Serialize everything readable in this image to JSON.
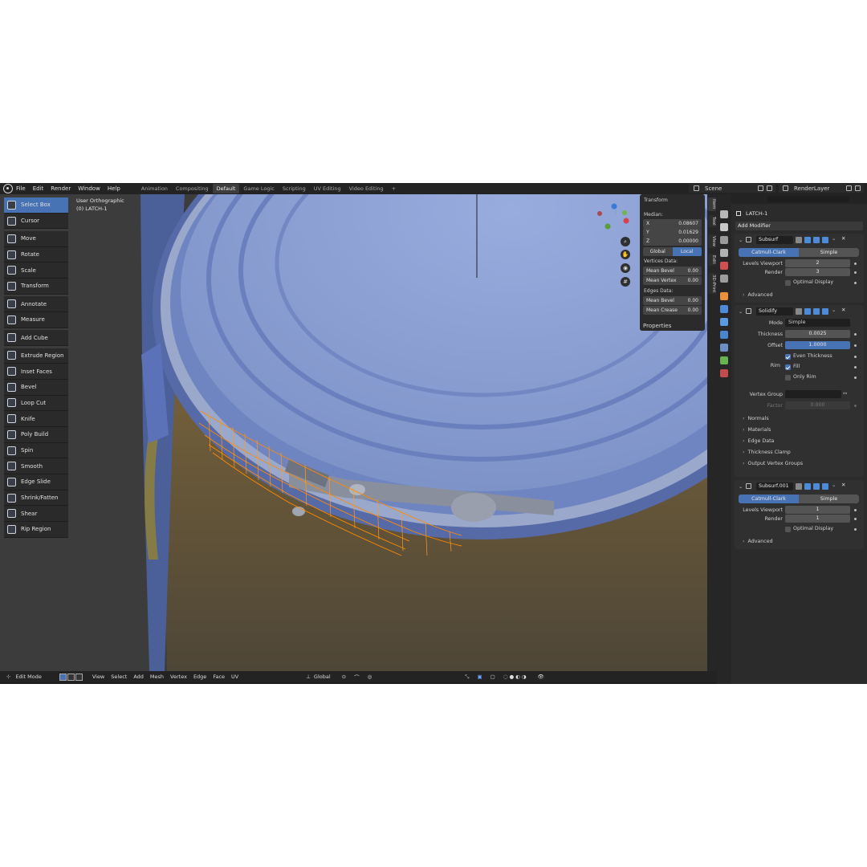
{
  "menu": [
    "File",
    "Edit",
    "Render",
    "Window",
    "Help"
  ],
  "workspaces": [
    "Animation",
    "Compositing",
    "Default",
    "Game Logic",
    "Scripting",
    "UV Editing",
    "Video Editing"
  ],
  "workspace_add": "+",
  "scene": "Scene",
  "render_layer": "RenderLayer",
  "tools": [
    {
      "label": "Select Box",
      "active": true
    },
    {
      "label": "Cursor"
    },
    {
      "label": "Move"
    },
    {
      "label": "Rotate"
    },
    {
      "label": "Scale"
    },
    {
      "label": "Transform"
    },
    {
      "label": "Annotate"
    },
    {
      "label": "Measure"
    },
    {
      "label": "Add Cube"
    },
    {
      "label": "Extrude Region"
    },
    {
      "label": "Inset Faces"
    },
    {
      "label": "Bevel"
    },
    {
      "label": "Loop Cut"
    },
    {
      "label": "Knife"
    },
    {
      "label": "Poly Build"
    },
    {
      "label": "Spin"
    },
    {
      "label": "Smooth"
    },
    {
      "label": "Edge Slide"
    },
    {
      "label": "Shrink/Fatten"
    },
    {
      "label": "Shear"
    },
    {
      "label": "Rip Region"
    }
  ],
  "viewport": {
    "view_name": "User Orthographic",
    "object_name": "(0) LATCH-1"
  },
  "npanel": {
    "title": "Transform",
    "median_label": "Median:",
    "x_label": "X",
    "x_value": "0.08607",
    "y_label": "Y",
    "y_value": "0.01629",
    "z_label": "Z",
    "z_value": "0.00000",
    "global_label": "Global",
    "local_label": "Local",
    "vertices_data": "Vertices Data:",
    "mean_bevel_label": "Mean Bevel",
    "mean_bevel_value": "0.00",
    "mean_vertex_label": "Mean Vertex",
    "mean_vertex_value": "0.00",
    "edges_data": "Edges Data:",
    "edge_mean_bevel_label": "Mean Bevel",
    "edge_mean_bevel_value": "0.00",
    "mean_crease_label": "Mean Crease",
    "mean_crease_value": "0.00",
    "properties": "Properties"
  },
  "side_tabs": [
    "Item",
    "Tool",
    "View",
    "Edit",
    "3D-Print"
  ],
  "bottom": {
    "mode": "Edit Mode",
    "menus": [
      "View",
      "Select",
      "Add",
      "Mesh",
      "Vertex",
      "Edge",
      "Face",
      "UV"
    ],
    "orientation": "Global"
  },
  "properties": {
    "object": "LATCH-1",
    "add_modifier": "Add Modifier",
    "subsurf": {
      "name": "Subsurf",
      "catmull": "Catmull-Clark",
      "simple": "Simple",
      "levels_viewport_label": "Levels Viewport",
      "levels_viewport": "2",
      "render_label": "Render",
      "render": "3",
      "optimal_display": "Optimal Display",
      "advanced": "Advanced"
    },
    "solidify": {
      "name": "Solidify",
      "mode_label": "Mode",
      "mode": "Simple",
      "thickness_label": "Thickness",
      "thickness": "0.0025",
      "offset_label": "Offset",
      "offset": "1.0000",
      "even_thickness": "Even Thickness",
      "rim_label": "Rim",
      "fill": "Fill",
      "only_rim": "Only Rim",
      "vertex_group_label": "Vertex Group",
      "factor_label": "Factor",
      "factor": "0.000",
      "sections": [
        "Normals",
        "Materials",
        "Edge Data",
        "Thickness Clamp",
        "Output Vertex Groups"
      ]
    },
    "subsurf2": {
      "name": "Subsurf.001",
      "catmull": "Catmull-Clark",
      "simple": "Simple",
      "levels_viewport_label": "Levels Viewport",
      "levels_viewport": "1",
      "render_label": "Render",
      "render": "1",
      "optimal_display": "Optimal Display",
      "advanced": "Advanced"
    }
  },
  "colors": {
    "accent": "#4772b3",
    "lid": "#8a9fd4",
    "bucket": "#6b5632",
    "selection": "#ff8a00"
  }
}
